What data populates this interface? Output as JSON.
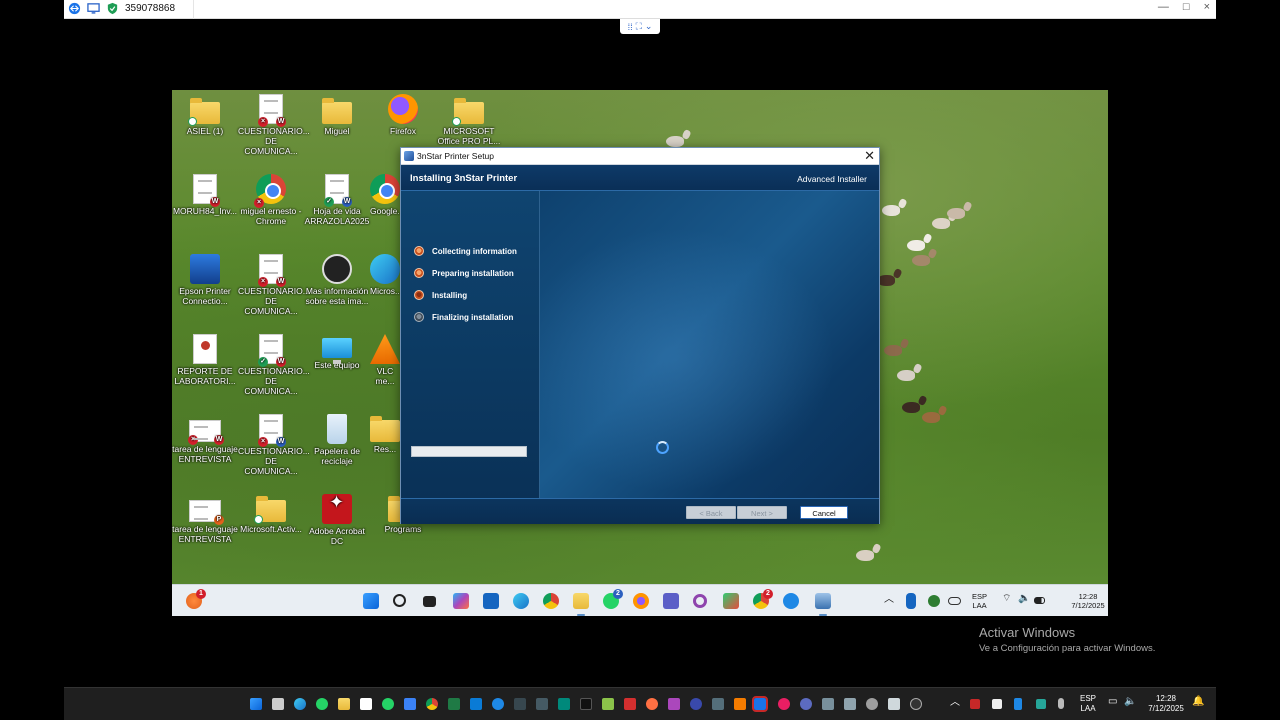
{
  "viewer": {
    "session_id": "359078868",
    "window_controls": [
      "—",
      "□",
      "×"
    ]
  },
  "desktop_icons": [
    {
      "label": "ASIEL (1)",
      "icon": "folder-icon"
    },
    {
      "label": "CUESTIONARIO... DE COMUNICA...",
      "icon": "word-document-icon"
    },
    {
      "label": "Miguel",
      "icon": "folder-icon"
    },
    {
      "label": "Firefox",
      "icon": "firefox-icon"
    },
    {
      "label": "MICROSOFT Office PRO PL...",
      "icon": "folder-icon"
    },
    {
      "label": "MORUH84_Inv...",
      "icon": "document-icon"
    },
    {
      "label": "miguel ernesto - Chrome",
      "icon": "chrome-icon"
    },
    {
      "label": "Hoja de vida ARRAZOLA2025",
      "icon": "word-document-icon"
    },
    {
      "label": "Google...",
      "icon": "chrome-icon"
    },
    {
      "label": "Epson Printer Connectio...",
      "icon": "epson-icon"
    },
    {
      "label": "CUESTIONARIO... DE COMUNICA...",
      "icon": "word-document-icon"
    },
    {
      "label": "Mas información sobre esta ima...",
      "icon": "info-icon"
    },
    {
      "label": "Micros...",
      "icon": "edge-icon"
    },
    {
      "label": "REPORTE DE LABORATORI...",
      "icon": "certificate-icon"
    },
    {
      "label": "CUESTIONARIO... DE COMUNICA...",
      "icon": "word-document-icon"
    },
    {
      "label": "Este equipo",
      "icon": "computer-icon"
    },
    {
      "label": "VLC me...",
      "icon": "vlc-icon"
    },
    {
      "label": "tarea de lenguaje ENTREVISTA",
      "icon": "document-icon"
    },
    {
      "label": "CUESTIONARIO... DE COMUNICA...",
      "icon": "word-document-icon"
    },
    {
      "label": "Papelera de reciclaje",
      "icon": "recycle-bin-icon"
    },
    {
      "label": "Res...",
      "icon": "folder-icon"
    },
    {
      "label": "tarea de lenguaje ENTREVISTA",
      "icon": "powerpoint-icon"
    },
    {
      "label": "Microsoft.Activ...",
      "icon": "folder-icon"
    },
    {
      "label": "Adobe Acrobat DC",
      "icon": "acrobat-icon"
    },
    {
      "label": "Programs",
      "icon": "folder-icon"
    }
  ],
  "installer": {
    "window_title": "3nStar Printer Setup",
    "header_title": "Installing 3nStar Printer",
    "vendor": "Advanced Installer",
    "steps": [
      {
        "label": "Collecting information",
        "state": "done"
      },
      {
        "label": "Preparing installation",
        "state": "done"
      },
      {
        "label": "Installing",
        "state": "current"
      },
      {
        "label": "Finalizing installation",
        "state": "pending"
      }
    ],
    "progress": 0,
    "buttons": {
      "back": "< Back",
      "next": "Next >",
      "cancel": "Cancel"
    }
  },
  "remote_taskbar": {
    "weather_badge": "1",
    "whatsapp_badge": "2",
    "chrome_badge": "2",
    "language": [
      "ESP",
      "LAA"
    ],
    "time": "12:28",
    "date": "7/12/2025"
  },
  "activation": {
    "line1": "Activar Windows",
    "line2": "Ve a Configuración para activar Windows."
  },
  "host_taskbar": {
    "language": [
      "ESP",
      "LAA"
    ],
    "time": "12:28",
    "date": "7/12/2025"
  },
  "colors": {
    "installer_bg": "#0c3b66",
    "accent_orange": "#c84e1b",
    "taskbar_remote": "#e9eef3",
    "taskbar_host": "#1f1f1f"
  }
}
